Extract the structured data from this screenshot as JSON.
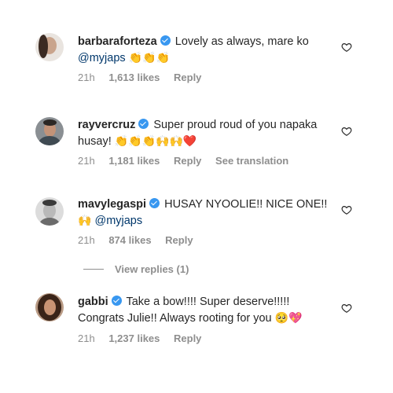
{
  "comments": [
    {
      "username": "barbaraforteza",
      "verified": true,
      "text_line1": "Lovely as always, mare ko",
      "mention": "@myjaps",
      "emoji_line2": "👏👏👏",
      "time": "21h",
      "likes": "1,613 likes",
      "reply": "Reply"
    },
    {
      "username": "rayvercruz",
      "verified": true,
      "text_line1": "Super proud roud of you napaka",
      "text_line2": "husay!",
      "emoji_line2": "👏👏👏🙌🙌❤️",
      "time": "21h",
      "likes": "1,181 likes",
      "reply": "Reply",
      "see_translation": "See translation"
    },
    {
      "username": "mavylegaspi",
      "verified": true,
      "text_line1": "HUSAY NYOOLIE!! NICE ONE!!",
      "emoji_line2": "🙌",
      "mention": "@myjaps",
      "time": "21h",
      "likes": "874 likes",
      "reply": "Reply",
      "view_replies": "View replies (1)"
    },
    {
      "username": "gabbi",
      "verified": true,
      "text_line1": "Take a bow!!!! Super deserve!!!!!",
      "text_line2": "Congrats Julie!! Always rooting for you",
      "emoji_line2": "🥺💖",
      "time": "21h",
      "likes": "1,237 likes",
      "reply": "Reply"
    }
  ]
}
